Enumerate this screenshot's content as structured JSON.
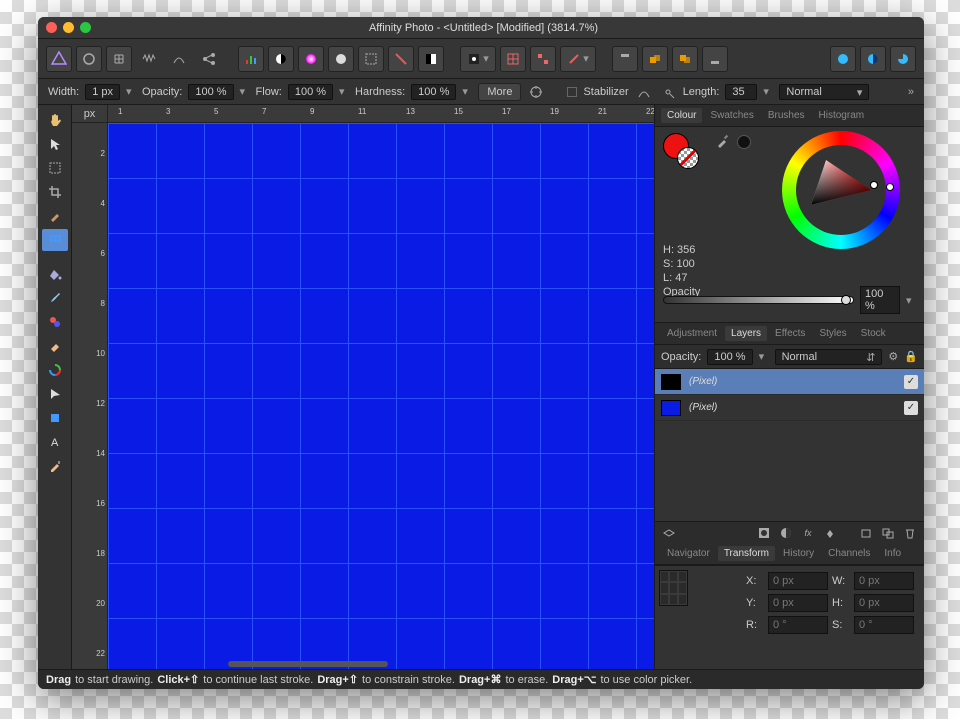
{
  "window": {
    "title": "Affinity Photo - <Untitled> [Modified] (3814.7%)",
    "traffic": {
      "close": "#ff5f57",
      "min": "#febc2e",
      "max": "#28c840"
    }
  },
  "contextbar": {
    "width_label": "Width:",
    "width_value": "1 px",
    "opacity_label": "Opacity:",
    "opacity_value": "100 %",
    "flow_label": "Flow:",
    "flow_value": "100 %",
    "hardness_label": "Hardness:",
    "hardness_value": "100 %",
    "more_label": "More",
    "stabilizer_label": "Stabilizer",
    "length_label": "Length:",
    "length_value": "35",
    "blend_mode": "Normal"
  },
  "ruler": {
    "unit_label": "px",
    "h_marks": [
      "1",
      "3",
      "5",
      "7",
      "9",
      "11",
      "13",
      "15",
      "17",
      "19",
      "21",
      "22"
    ],
    "v_marks": [
      "2",
      "4",
      "6",
      "8",
      "10",
      "12",
      "14",
      "16",
      "18",
      "20",
      "22"
    ]
  },
  "panels": {
    "color_tabs": [
      "Colour",
      "Swatches",
      "Brushes",
      "Histogram"
    ],
    "color_active": 0,
    "hsl": {
      "h_label": "H: 356",
      "s_label": "S: 100",
      "l_label": "L: 47"
    },
    "opacity_label": "Opacity",
    "opacity_value": "100 %",
    "layer_tabs": [
      "Adjustment",
      "Layers",
      "Effects",
      "Styles",
      "Stock"
    ],
    "layer_active": 1,
    "layer_opts": {
      "opacity_label": "Opacity:",
      "opacity_value": "100 %",
      "blend": "Normal"
    },
    "layers": [
      {
        "name": "(Pixel)",
        "color": "#000000",
        "selected": true,
        "visible": true
      },
      {
        "name": "(Pixel)",
        "color": "#0b1be6",
        "selected": false,
        "visible": true
      }
    ],
    "transform_tabs": [
      "Navigator",
      "Transform",
      "History",
      "Channels",
      "Info"
    ],
    "transform_active": 1,
    "transform": {
      "x_label": "X:",
      "x_value": "0 px",
      "y_label": "Y:",
      "y_value": "0 px",
      "w_label": "W:",
      "w_value": "0 px",
      "h_label": "H:",
      "h_value": "0 px",
      "r_label": "R:",
      "r_value": "0 °",
      "s_label": "S:",
      "s_value": "0 °"
    }
  },
  "statusbar": {
    "parts": [
      {
        "b": "Drag",
        "t": " to start drawing. "
      },
      {
        "b": "Click+⇧",
        "t": " to continue last stroke. "
      },
      {
        "b": "Drag+⇧",
        "t": " to constrain stroke. "
      },
      {
        "b": "Drag+⌘",
        "t": " to erase. "
      },
      {
        "b": "Drag+⌥",
        "t": " to use color picker."
      }
    ]
  },
  "canvas": {
    "fill": "#0b1be6"
  }
}
